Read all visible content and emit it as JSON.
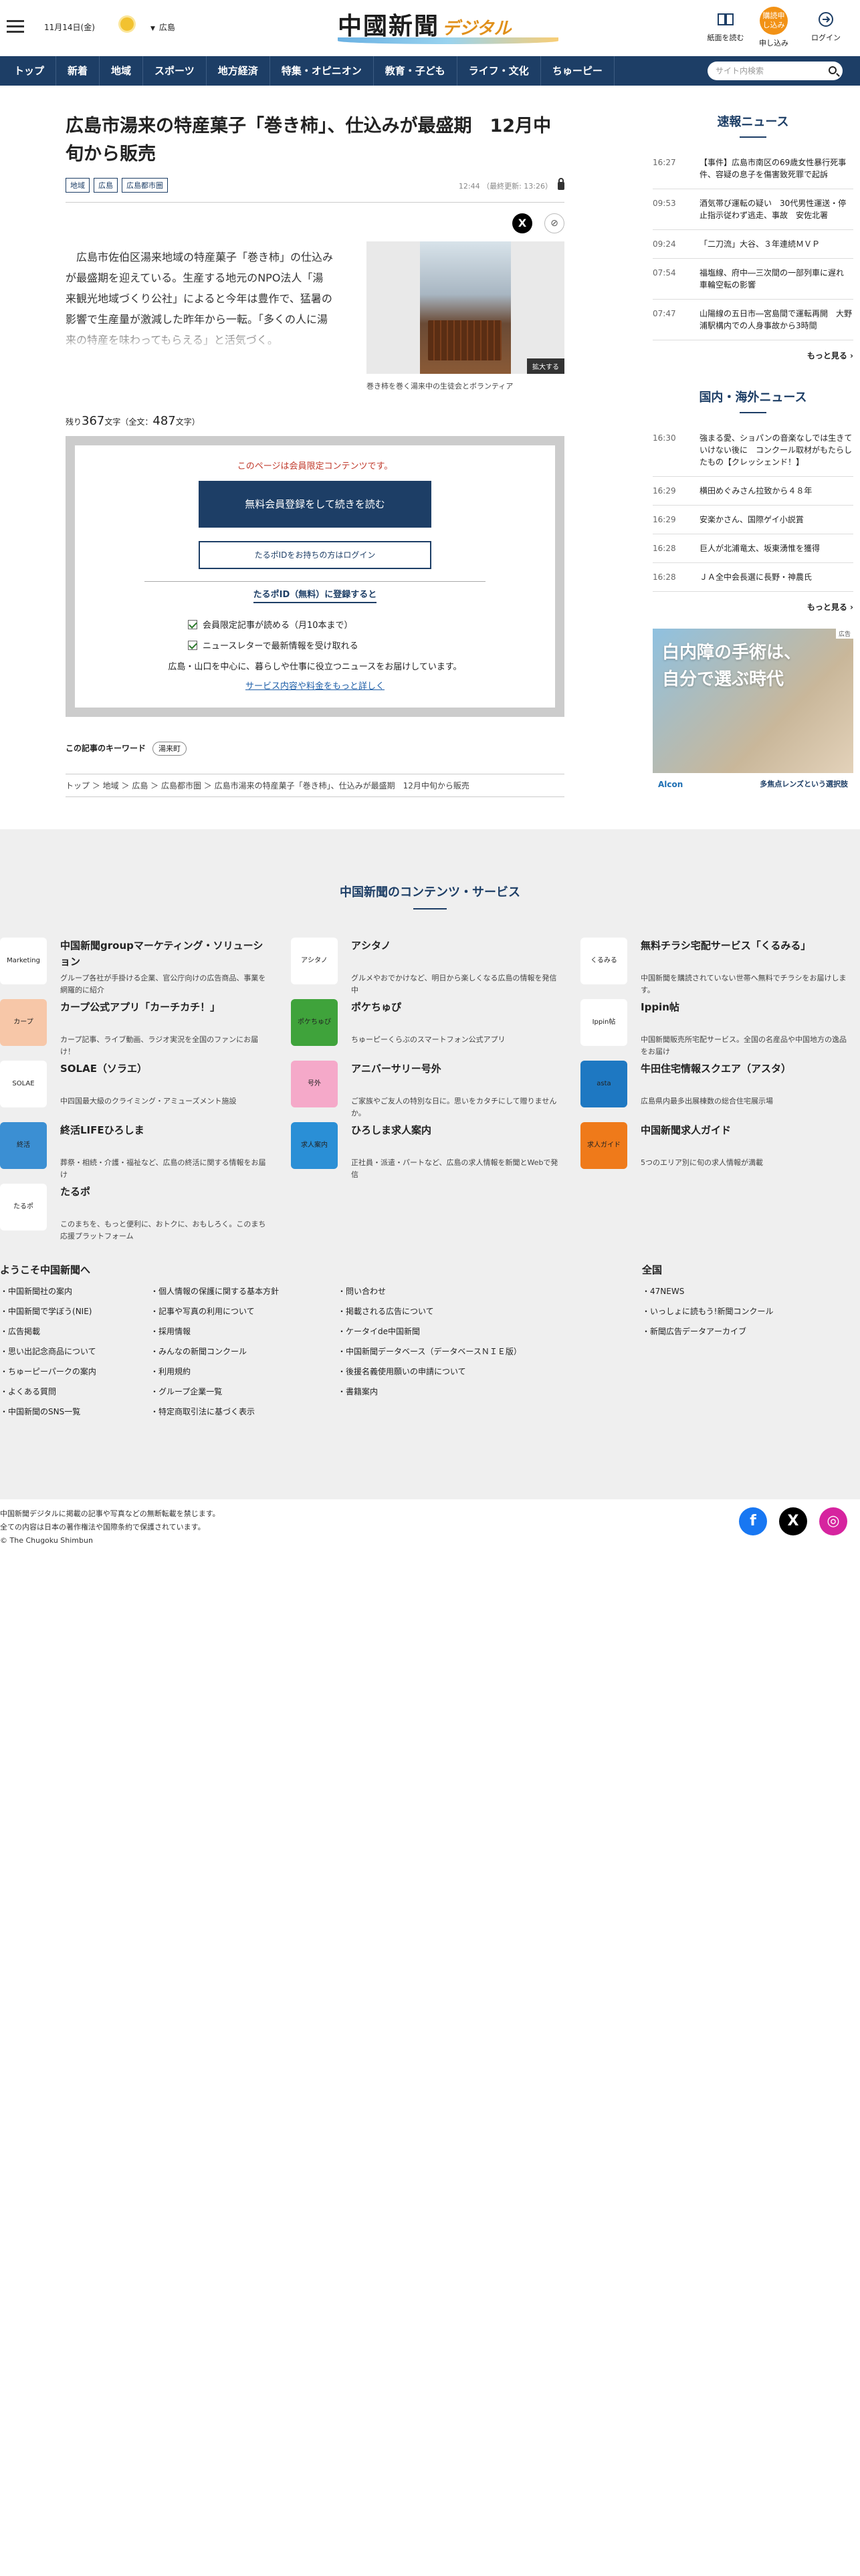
{
  "header": {
    "date": "11月14日(金)",
    "weather_icon": "sun-icon",
    "region": "広島",
    "logo_main": "中國新聞",
    "logo_sub": "デジタル",
    "buttons": [
      {
        "label": "紙面を読む",
        "icon": "newspaper-icon"
      },
      {
        "label": "申し込み",
        "badge": "購読申し込み"
      },
      {
        "label": "ログイン",
        "icon": "login-icon"
      }
    ]
  },
  "nav": {
    "items": [
      "トップ",
      "新着",
      "地域",
      "スポーツ",
      "地方経済",
      "特集・オピニオン",
      "教育・子ども",
      "ライフ・文化",
      "ちゅーピー"
    ],
    "search_placeholder": "サイト内検索"
  },
  "article": {
    "title": "広島市湯来の特産菓子「巻き柿」、仕込みが最盛期　12月中旬から販売",
    "tags": [
      "地域",
      "広島",
      "広島都市圏"
    ],
    "time": "12:44",
    "updated": "（最終更新: 13:26）",
    "lead": "　広島市佐伯区湯来地域の特産菓子「巻き柿」の仕込みが最盛期を迎えている。生産する地元のNPO法人「湯来観光地域づくり公社」によると今年は豊作で、猛暑の影響で生産量が激減した昨年から一転。「多くの人に湯来の特産を味わってもらえる」と活気づく。",
    "photo_enlarge": "拡大する",
    "caption": "巻き柿を巻く湯来中の生徒会とボランティア",
    "remain_prefix": "残り",
    "remain": "367",
    "remain_mid": "文字（全文：",
    "total": "487",
    "remain_suffix": "文字）"
  },
  "paywall": {
    "message": "このページは会員限定コンテンツです。",
    "primary": "無料会員登録をして続きを読む",
    "secondary": "たるポIDをお持ちの方はログイン",
    "id_head": "たるポID（無料）に登録すると",
    "benefits": [
      "会員限定記事が読める（月10本まで）",
      "ニュースレターで最新情報を受け取れる"
    ],
    "note": "広島・山口を中心に、暮らしや仕事に役立つニュースをお届けしています。",
    "more": "サービス内容や料金をもっと詳しく"
  },
  "keywords": {
    "label": "この記事のキーワード",
    "items": [
      "湯来町"
    ]
  },
  "breadcrumb": [
    "トップ",
    "地域",
    "広島",
    "広島都市圏",
    "広島市湯来の特産菓子「巻き柿」、仕込みが最盛期　12月中旬から販売"
  ],
  "sidebar": {
    "breaking": {
      "title": "速報ニュース",
      "items": [
        {
          "time": "16:27",
          "text": "【事件】広島市南区の69歳女性暴行死事件、容疑の息子を傷害致死罪で起訴"
        },
        {
          "time": "09:53",
          "text": "酒気帯び運転の疑い　30代男性運送・停止指示従わず逃走、事故　安佐北署"
        },
        {
          "time": "09:24",
          "text": "「二刀流」大谷、３年連続ＭＶＰ"
        },
        {
          "time": "07:54",
          "text": "福塩線、府中―三次間の一部列車に遅れ　車輪空転の影響"
        },
        {
          "time": "07:47",
          "text": "山陽線の五日市―宮島間で運転再開　大野浦駅構内での人身事故から3時間"
        }
      ],
      "more": "もっと見る"
    },
    "national": {
      "title": "国内・海外ニュース",
      "items": [
        {
          "time": "16:30",
          "text": "強まる愛、ショパンの音楽なしでは生きていけない後に　コンクール取材がもたらしたもの【クレッシェンド！】"
        },
        {
          "time": "16:29",
          "text": "横田めぐみさん拉致から４８年"
        },
        {
          "time": "16:29",
          "text": "安楽かさん、国際ゲイ小説賞"
        },
        {
          "time": "16:28",
          "text": "巨人が北浦竜太、坂東湧惟を獲得"
        },
        {
          "time": "16:28",
          "text": "ＪＡ全中会長選に長野・神農氏"
        }
      ],
      "more": "もっと見る"
    },
    "ad": {
      "headline1": "白内障の手術は、",
      "headline2": "自分で選ぶ時代",
      "brand": "Alcon",
      "cta": "多焦点レンズという選択肢",
      "mark": "広告"
    }
  },
  "services": {
    "title": "中国新聞のコンテンツ・サービス",
    "items": [
      {
        "name": "中国新聞groupマーケティング・ソリューション",
        "desc": "グループ各社が手掛ける企業、官公庁向けの広告商品、事業を網羅的に紹介",
        "logo": "Marketing Online"
      },
      {
        "name": "アシタノ",
        "desc": "グルメやおでかけなど、明日から楽しくなる広島の情報を発信中",
        "logo": "アシタノ"
      },
      {
        "name": "無料チラシ宅配サービス「くるみる」",
        "desc": "中国新聞を購読されていない世帯へ無料でチラシをお届けします。",
        "logo": "くるみる"
      },
      {
        "name": "カープ公式アプリ「カーチカチ！」",
        "desc": "カープ記事、ライブ動画、ラジオ実況を全国のファンにお届け！",
        "logo": "カープ"
      },
      {
        "name": "ポケちゅぴ",
        "desc": "ちゅーピーくらぶのスマートフォン公式アプリ",
        "logo": "ポケちゅぴ"
      },
      {
        "name": "Ippin帖",
        "desc": "中国新聞販売所宅配サービス。全国の名産品や中国地方の逸品をお届け",
        "logo": "Ippin帖"
      },
      {
        "name": "SOLAE（ソラエ）",
        "desc": "中四国最大級のクライミング・アミューズメント施設",
        "logo": "SOLAE"
      },
      {
        "name": "アニバーサリー号外",
        "desc": "ご家族やご友人の特別な日に。思いをカタチにして贈りませんか。",
        "logo": "号外"
      },
      {
        "name": "牛田住宅情報スクエア（アスタ）",
        "desc": "広島県内最多出展棟数の総合住宅展示場",
        "logo": "asta"
      },
      {
        "name": "終活LIFEひろしま",
        "desc": "葬祭・相続・介護・福祉など、広島の終活に関する情報をお届け",
        "logo": "終活"
      },
      {
        "name": "ひろしま求人案内",
        "desc": "正社員・派遣・パートなど、広島の求人情報を新聞とWebで発信",
        "logo": "求人案内"
      },
      {
        "name": "中国新聞求人ガイド",
        "desc": "5つのエリア別に旬の求人情報が満載",
        "logo": "求人ガイド"
      },
      {
        "name": "たるポ",
        "desc": "このまちを、もっと便利に、おトクに、おもしろく。このまち応援プラットフォーム",
        "logo": "たるポ"
      }
    ]
  },
  "footer": {
    "welcome": "ようこそ中国新聞へ",
    "zenkoku": "全国",
    "col1": [
      "中国新聞社の案内",
      "中国新聞で学ぼう(NIE)",
      "広告掲載",
      "思い出記念商品について",
      "ちゅーピーパークの案内",
      "よくある質問",
      "中国新聞のSNS一覧"
    ],
    "col2": [
      "個人情報の保護に関する基本方針",
      "記事や写真の利用について",
      "採用情報",
      "みんなの新聞コンクール",
      "利用規約",
      "グループ企業一覧",
      "特定商取引法に基づく表示"
    ],
    "col3": [
      "問い合わせ",
      "掲載される広告について",
      "ケータイde中国新聞",
      "中国新聞データベース（データベースＮＩＥ版）",
      "後援名義使用願いの申請について",
      "書籍案内"
    ],
    "col4": [
      "47NEWS",
      "いっしょに読もう!新聞コンクール",
      "新聞広告データアーカイブ"
    ],
    "copy1": "中国新聞デジタルに掲載の記事や写真などの無断転載を禁じます。",
    "copy2": "全ての内容は日本の著作権法や国際条約で保護されています。",
    "copy3": "© The Chugoku Shimbun",
    "sns": [
      {
        "icon": "facebook-icon",
        "glyph": "f",
        "color": "#1877f2"
      },
      {
        "icon": "x-icon",
        "glyph": "X",
        "color": "#000000"
      },
      {
        "icon": "instagram-icon",
        "glyph": "◎",
        "color": "#d6249f"
      }
    ]
  }
}
